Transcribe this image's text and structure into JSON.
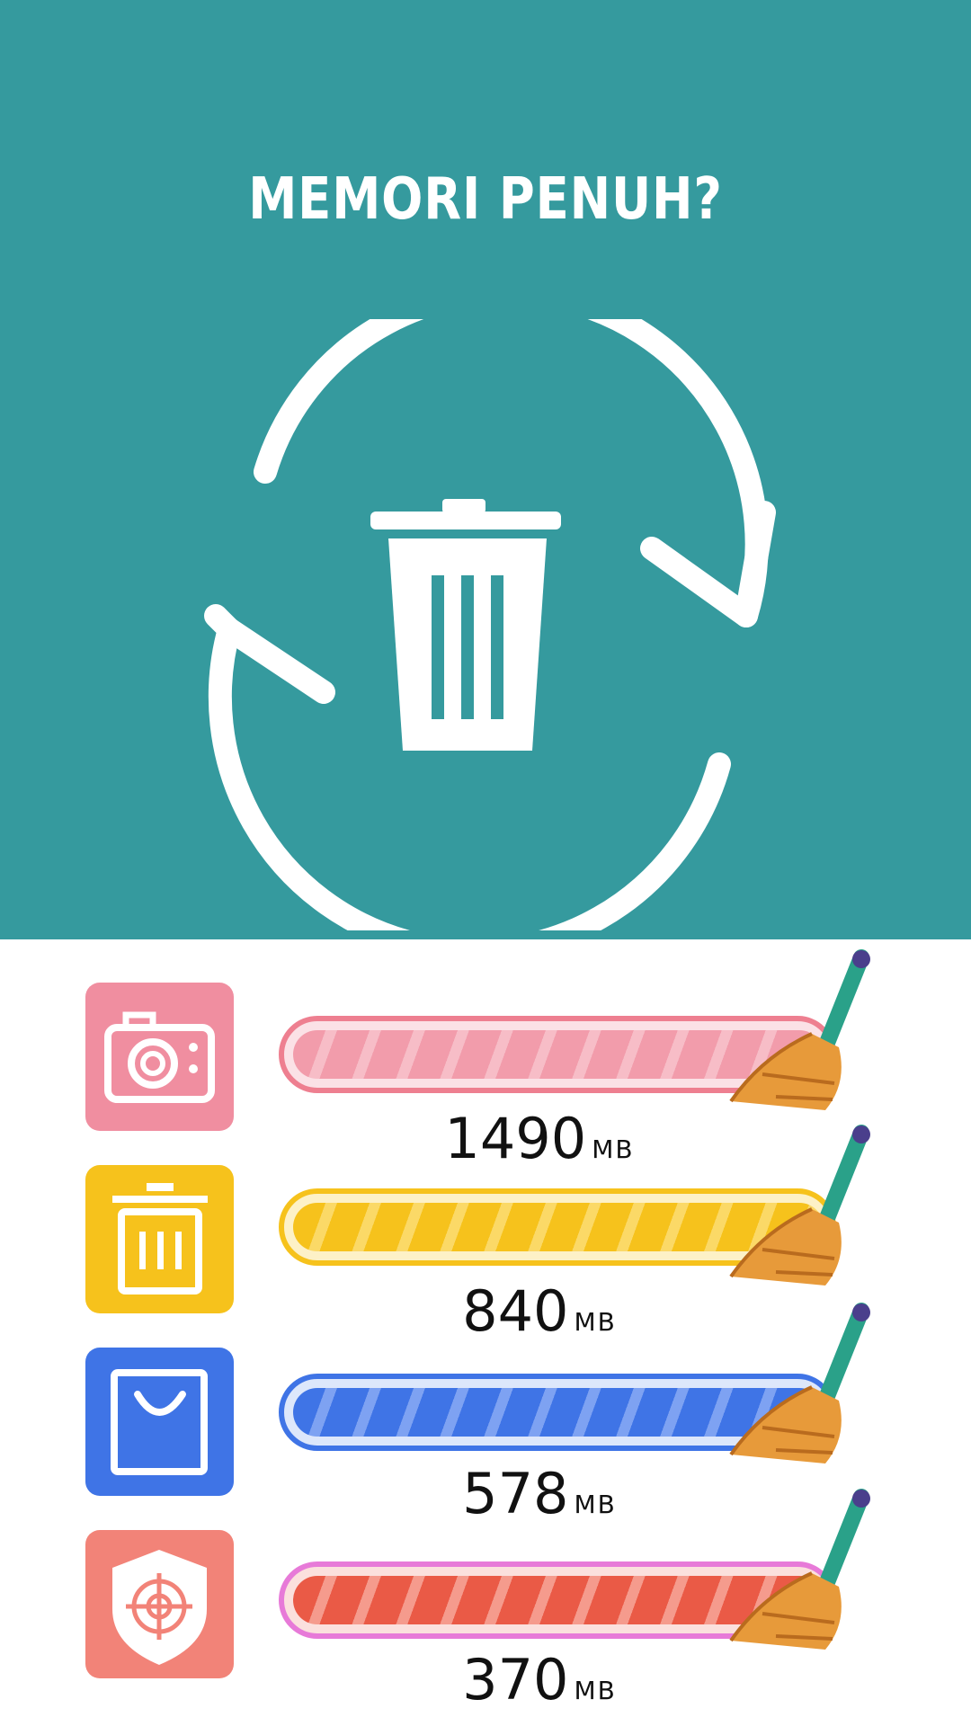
{
  "hero": {
    "title": "MEMORI PENUH?",
    "background": "#359a9e",
    "icon": "trash-recycle-icon"
  },
  "rows": [
    {
      "icon": "camera-icon",
      "color": "#f08ea0",
      "track": "#fbe1e6",
      "fill": "#f29cab",
      "value": "1490",
      "unit": "MB",
      "fill_fraction": 0.92
    },
    {
      "icon": "trash-icon",
      "color": "#f6c21c",
      "track": "#fdf1c7",
      "fill": "#f6c21c",
      "value": "840",
      "unit": "MB",
      "fill_fraction": 0.92
    },
    {
      "icon": "shopping-bag-icon",
      "color": "#3f74e6",
      "track": "#dde7fb",
      "fill": "#3f74e6",
      "value": "578",
      "unit": "MB",
      "fill_fraction": 0.92
    },
    {
      "icon": "shield-target-icon",
      "color": "#f28378",
      "track": "#fbe0dd",
      "fill": "#ea5a46",
      "value": "370",
      "unit": "MB",
      "fill_fraction": 0.92
    }
  ]
}
